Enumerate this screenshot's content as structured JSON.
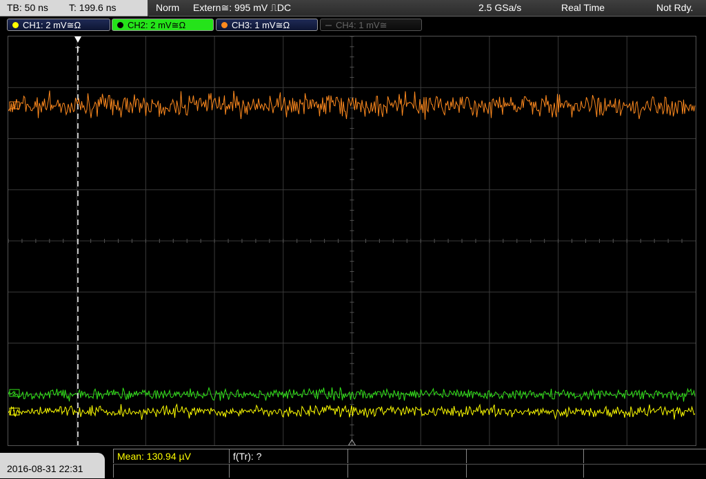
{
  "status": {
    "timebase": "TB: 50 ns",
    "trigger_time": "T: 199.6 ns",
    "trigger_mode": "Norm",
    "trigger_source": "Extern≅: 995 mV ⎍DC",
    "sample_rate": "2.5 GSa/s",
    "acq_mode": "Real Time",
    "state": "Not Rdy."
  },
  "channels": [
    {
      "label": "CH1: 2 mV≅Ω",
      "color": "#ffff00",
      "active": false,
      "enabled": true
    },
    {
      "label": "CH2: 2 mV≅Ω",
      "color": "#33e61a",
      "active": true,
      "enabled": true
    },
    {
      "label": "CH3: 1 mV≅Ω",
      "color": "#ff8a1e",
      "active": false,
      "enabled": true
    },
    {
      "label": "CH4: 1 mV≅",
      "color": "#666666",
      "active": false,
      "enabled": false
    }
  ],
  "screen": {
    "trigger_marker": "T",
    "ch_markers": [
      "3",
      "2",
      "1"
    ]
  },
  "footer": {
    "datetime": "2016-08-31 22:31",
    "measurement": "Mean: 130.94 µV",
    "freq": "f(Tr): ?"
  },
  "colors": {
    "ch1": "#ffff00",
    "ch2": "#33e61a",
    "ch3": "#ff8a1e",
    "grid": "#3a3a3a"
  }
}
